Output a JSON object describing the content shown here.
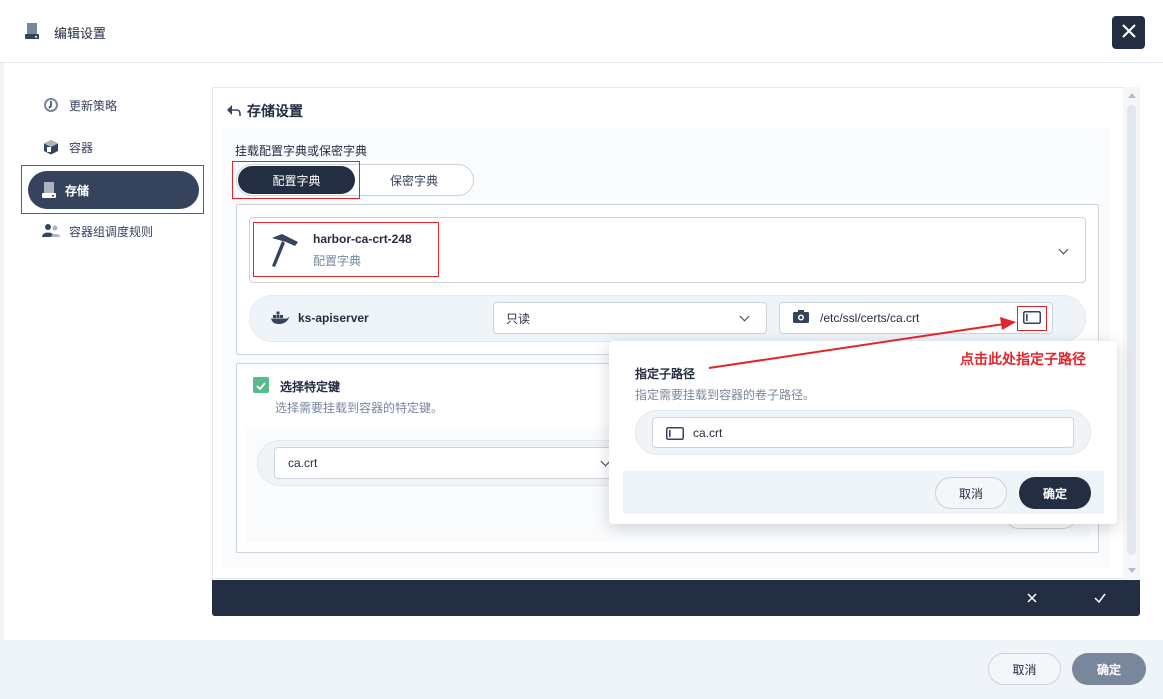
{
  "header": {
    "title": "编辑设置",
    "close_icon": "close-icon"
  },
  "sidebar": {
    "items": [
      {
        "label": "更新策略",
        "icon": "update-strategy-icon"
      },
      {
        "label": "容器",
        "icon": "container-icon"
      },
      {
        "label": "存储",
        "icon": "storage-icon",
        "active": true
      },
      {
        "label": "容器组调度规则",
        "icon": "scheduling-icon"
      }
    ]
  },
  "storage": {
    "section_title": "存储设置",
    "mount_label": "挂载配置字典或保密字典",
    "tabs": [
      {
        "label": "配置字典",
        "active": true
      },
      {
        "label": "保密字典",
        "active": false
      }
    ],
    "configmap": {
      "name": "harbor-ca-crt-248",
      "type": "配置字典"
    },
    "container": {
      "name": "ks-apiserver",
      "mode": "只读",
      "mount_path": "/etc/ssl/certs/ca.crt"
    },
    "keys": {
      "title": "选择特定键",
      "description": "选择需要挂载到容器的特定键。",
      "checked": true,
      "selected_key": "ca.crt"
    }
  },
  "popover": {
    "title": "指定子路径",
    "description": "指定需要挂载到容器的卷子路径。",
    "subpath_value": "ca.crt",
    "cancel_label": "取消",
    "ok_label": "确定"
  },
  "annotation": {
    "text": "点击此处指定子路径",
    "color": "#e0262b"
  },
  "footer": {
    "cancel_label": "取消",
    "ok_label": "确定"
  },
  "colors": {
    "primary": "#242e42",
    "accent_red": "#e0262b",
    "check_green": "#55bc8a",
    "muted": "#79879c"
  }
}
